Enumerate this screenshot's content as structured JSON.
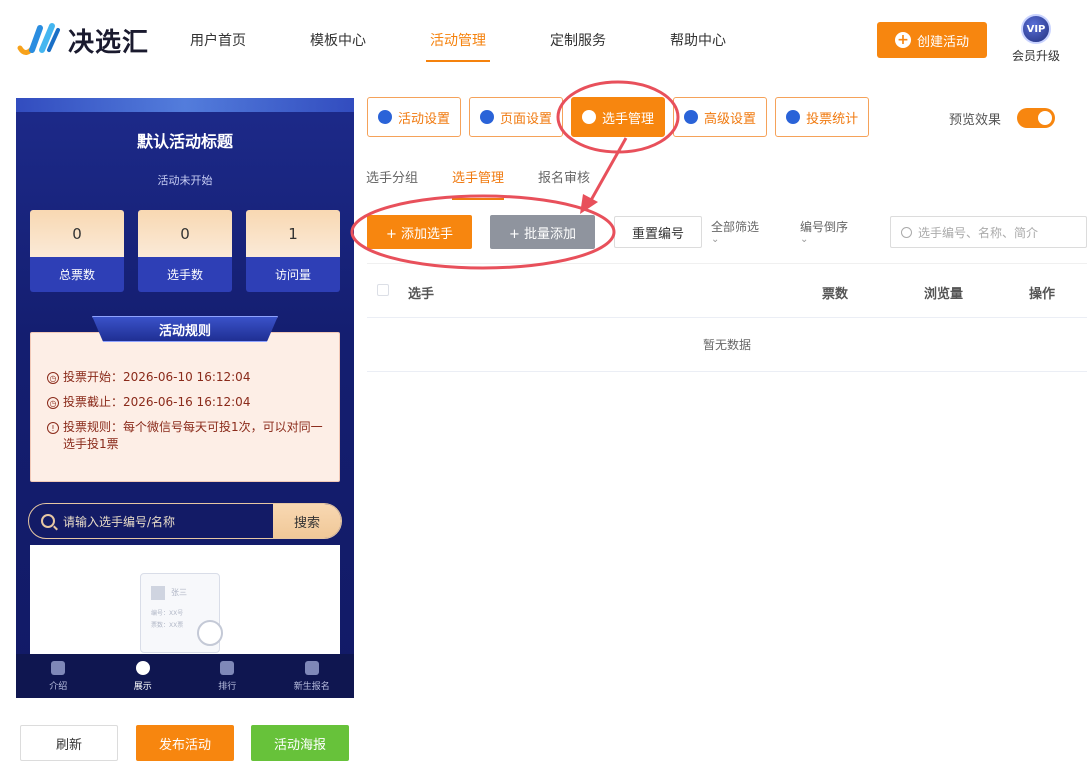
{
  "brand": {
    "name": "决选汇"
  },
  "nav": {
    "items": [
      {
        "label": "用户首页",
        "active": false
      },
      {
        "label": "模板中心",
        "active": false
      },
      {
        "label": "活动管理",
        "active": true
      },
      {
        "label": "定制服务",
        "active": false
      },
      {
        "label": "帮助中心",
        "active": false
      }
    ],
    "create_label": "创建活动",
    "vip_badge": "VIP",
    "vip_label": "会员升级"
  },
  "preview": {
    "title": "默认活动标题",
    "status": "活动未开始",
    "stats": [
      {
        "value": "0",
        "label": "总票数"
      },
      {
        "value": "0",
        "label": "选手数"
      },
      {
        "value": "1",
        "label": "访问量"
      }
    ],
    "rules_title": "活动规则",
    "rules": [
      {
        "text": "投票开始：2026-06-10 16:12:04"
      },
      {
        "text": "投票截止：2026-06-16 16:12:04"
      },
      {
        "text": "投票规则：每个微信号每天可投1次，可以对同一选手投1票"
      }
    ],
    "search_placeholder": "请输入选手编号/名称",
    "search_button": "搜索",
    "empty_card": {
      "name": "张三",
      "code": "编号：XX号",
      "votes": "票数：XX票"
    },
    "tabbar": [
      {
        "label": "介绍",
        "active": false
      },
      {
        "label": "展示",
        "active": true
      },
      {
        "label": "排行",
        "active": false
      },
      {
        "label": "新生报名",
        "active": false
      }
    ]
  },
  "bottom_buttons": {
    "refresh": "刷新",
    "publish": "发布活动",
    "poster": "活动海报"
  },
  "settings_tabs": [
    {
      "label": "活动设置",
      "icon": "star-circle-icon",
      "active": false
    },
    {
      "label": "页面设置",
      "icon": "gear-icon",
      "active": false
    },
    {
      "label": "选手管理",
      "icon": "users-icon",
      "active": true
    },
    {
      "label": "高级设置",
      "icon": "sliders-icon",
      "active": false
    },
    {
      "label": "投票统计",
      "icon": "bar-chart-icon",
      "active": false
    }
  ],
  "preview_toggle": {
    "label": "预览效果",
    "on": true
  },
  "sub_tabs": [
    {
      "label": "选手分组",
      "active": false
    },
    {
      "label": "选手管理",
      "active": true
    },
    {
      "label": "报名审核",
      "active": false
    }
  ],
  "toolbar": {
    "add_label": "+ 添加选手",
    "batch_label": "+ 批量添加",
    "reset_label": "重置编号",
    "filter_all": "全部筛选",
    "filter_order": "编号倒序",
    "search_placeholder": "选手编号、名称、简介"
  },
  "table": {
    "headers": {
      "name": "选手",
      "votes": "票数",
      "views": "浏览量",
      "ops": "操作"
    },
    "empty_text": "暂无数据"
  },
  "colors": {
    "accent": "#f7860f",
    "annotation": "#e8505b",
    "preview_bg": "#1d2a8a",
    "success": "#67c23a"
  }
}
